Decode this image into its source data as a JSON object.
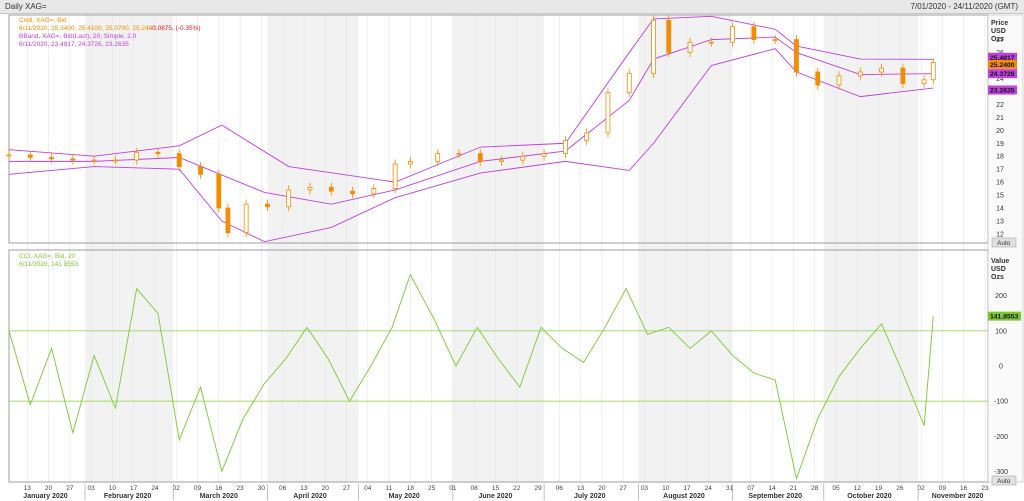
{
  "window": {
    "title": "Daily XAG=",
    "date_range": "7/01/2020 - 24/11/2020 (GMT)"
  },
  "legend_price": {
    "line1": "Cndl, XAG=, Bid",
    "line2_values": "6/11/2020, 25.3400, 25.4100, 25.0700, 25.2400,",
    "line2_change": "-0.0875, (-0.35%)",
    "line3": "BBand, XAG=, Bid(Last), 20, Simple, 2.0",
    "line4": "6/11/2020, 23.4817, 24.3726, 23.2635"
  },
  "legend_cci": {
    "line1": "CCI, XAG=, Bid, 20",
    "line2": "6/11/2020, 141.8553"
  },
  "axis_price": {
    "title_lines": [
      "Price",
      "USD",
      "Ozs"
    ],
    "ticks": [
      "27",
      "26",
      "25",
      "24",
      "23",
      "22",
      "21",
      "20",
      "19",
      "18",
      "17",
      "16",
      "15",
      "14",
      "13",
      "12"
    ],
    "badges": [
      "25.4817",
      "25.2400",
      "24.3726",
      "23.2635"
    ],
    "auto": "Auto"
  },
  "axis_cci": {
    "title_lines": [
      "Value",
      "USD",
      "Ozs"
    ],
    "ticks": [
      "200",
      "100",
      "0",
      "-100",
      "-200",
      "-300"
    ],
    "badge": "141.8553",
    "auto": "Auto"
  },
  "axis_x": {
    "day_ticks": [
      "13",
      "20",
      "27",
      "03",
      "10",
      "17",
      "24",
      "02",
      "09",
      "16",
      "23",
      "30",
      "06",
      "13",
      "20",
      "27",
      "04",
      "11",
      "18",
      "25",
      "01",
      "08",
      "15",
      "22",
      "29",
      "06",
      "13",
      "20",
      "27",
      "03",
      "10",
      "17",
      "24",
      "31",
      "07",
      "14",
      "21",
      "28",
      "05",
      "12",
      "19",
      "26",
      "02",
      "09",
      "16",
      "23"
    ],
    "months": [
      "January 2020",
      "February 2020",
      "March 2020",
      "April 2020",
      "May 2020",
      "June 2020",
      "July 2020",
      "August 2020",
      "September 2020",
      "October 2020",
      "November 2020"
    ]
  },
  "colors": {
    "candle": "#f28c00",
    "bband": "#c040e0",
    "cci": "#7cc832",
    "level_line": "#8ccf45",
    "change_negative": "#e02020",
    "badge_last": "#f28c00",
    "badge_band": "#c040e0",
    "badge_cci": "#7cc832"
  },
  "chart_data": [
    {
      "type": "candlestick",
      "title": "Daily XAG=",
      "series": [
        {
          "name": "Cndl, XAG=, Bid",
          "x": [
            "2020-01-07",
            "2020-01-14",
            "2020-01-21",
            "2020-01-28",
            "2020-02-04",
            "2020-02-11",
            "2020-02-18",
            "2020-02-25",
            "2020-03-03",
            "2020-03-10",
            "2020-03-16",
            "2020-03-19",
            "2020-03-25",
            "2020-04-01",
            "2020-04-08",
            "2020-04-15",
            "2020-04-22",
            "2020-04-29",
            "2020-05-06",
            "2020-05-13",
            "2020-05-18",
            "2020-05-27",
            "2020-06-03",
            "2020-06-10",
            "2020-06-17",
            "2020-06-24",
            "2020-07-01",
            "2020-07-08",
            "2020-07-15",
            "2020-07-22",
            "2020-07-29",
            "2020-08-06",
            "2020-08-11",
            "2020-08-18",
            "2020-08-25",
            "2020-09-01",
            "2020-09-08",
            "2020-09-15",
            "2020-09-22",
            "2020-09-29",
            "2020-10-06",
            "2020-10-13",
            "2020-10-20",
            "2020-10-27",
            "2020-11-03",
            "2020-11-06"
          ],
          "close": [
            18.1,
            17.9,
            17.8,
            17.7,
            17.7,
            17.7,
            18.3,
            18.2,
            17.2,
            16.6,
            14.0,
            12.1,
            14.3,
            14.1,
            15.4,
            15.6,
            15.3,
            15.1,
            15.5,
            17.4,
            17.6,
            18.2,
            18.2,
            17.6,
            17.7,
            18.0,
            18.2,
            19.2,
            19.8,
            22.9,
            24.4,
            28.5,
            26.0,
            26.8,
            26.8,
            28.0,
            27.0,
            27.0,
            24.5,
            23.5,
            24.2,
            24.5,
            24.8,
            23.6,
            23.9,
            25.24
          ]
        },
        {
          "name": "BBand upper",
          "x": [
            "2020-01-07",
            "2020-02-04",
            "2020-03-03",
            "2020-03-17",
            "2020-04-08",
            "2020-05-13",
            "2020-06-10",
            "2020-07-08",
            "2020-07-29",
            "2020-08-06",
            "2020-08-25",
            "2020-09-15",
            "2020-09-22",
            "2020-10-13",
            "2020-11-06"
          ],
          "values": [
            18.5,
            18.0,
            18.8,
            20.4,
            17.2,
            16.0,
            18.7,
            19.0,
            26.0,
            28.6,
            28.8,
            27.8,
            26.5,
            25.5,
            25.4817
          ]
        },
        {
          "name": "BBand middle",
          "x": [
            "2020-01-07",
            "2020-02-04",
            "2020-03-03",
            "2020-03-31",
            "2020-04-22",
            "2020-05-13",
            "2020-06-10",
            "2020-07-08",
            "2020-07-29",
            "2020-08-06",
            "2020-08-25",
            "2020-09-15",
            "2020-09-22",
            "2020-10-13",
            "2020-11-06"
          ],
          "values": [
            17.6,
            17.6,
            17.9,
            15.2,
            14.3,
            15.4,
            17.6,
            18.4,
            22.3,
            25.5,
            27.0,
            27.2,
            26.0,
            24.3,
            24.3726
          ]
        },
        {
          "name": "BBand lower",
          "x": [
            "2020-01-07",
            "2020-02-04",
            "2020-03-03",
            "2020-03-17",
            "2020-03-31",
            "2020-04-22",
            "2020-05-13",
            "2020-06-10",
            "2020-07-08",
            "2020-07-29",
            "2020-08-06",
            "2020-08-25",
            "2020-09-15",
            "2020-09-22",
            "2020-10-13",
            "2020-11-06"
          ],
          "values": [
            16.6,
            17.2,
            17.0,
            13.0,
            11.4,
            12.5,
            14.8,
            16.7,
            17.6,
            16.9,
            19.0,
            25.0,
            26.3,
            24.5,
            22.6,
            23.2635
          ]
        }
      ],
      "ylabel": "Price USD Ozs",
      "ylim": [
        11.3,
        28.9
      ]
    },
    {
      "type": "line",
      "title": "CCI, XAG=, Bid, 20",
      "series": [
        {
          "name": "CCI, XAG=, Bid, 20",
          "x": [
            "2020-01-07",
            "2020-01-14",
            "2020-01-21",
            "2020-01-28",
            "2020-02-04",
            "2020-02-11",
            "2020-02-18",
            "2020-02-25",
            "2020-03-03",
            "2020-03-10",
            "2020-03-17",
            "2020-03-24",
            "2020-03-31",
            "2020-04-07",
            "2020-04-14",
            "2020-04-21",
            "2020-04-28",
            "2020-05-05",
            "2020-05-12",
            "2020-05-18",
            "2020-05-26",
            "2020-06-02",
            "2020-06-09",
            "2020-06-16",
            "2020-06-23",
            "2020-06-30",
            "2020-07-07",
            "2020-07-14",
            "2020-07-21",
            "2020-07-28",
            "2020-08-04",
            "2020-08-11",
            "2020-08-18",
            "2020-08-25",
            "2020-09-01",
            "2020-09-08",
            "2020-09-15",
            "2020-09-22",
            "2020-09-29",
            "2020-10-06",
            "2020-10-13",
            "2020-10-20",
            "2020-10-27",
            "2020-11-03",
            "2020-11-06"
          ],
          "values": [
            100,
            -110,
            50,
            -190,
            30,
            -120,
            220,
            150,
            -210,
            -60,
            -300,
            -150,
            -50,
            20,
            110,
            20,
            -100,
            0,
            110,
            260,
            130,
            0,
            110,
            20,
            -60,
            110,
            50,
            10,
            110,
            220,
            90,
            110,
            50,
            100,
            30,
            -20,
            -40,
            -320,
            -150,
            -30,
            50,
            120,
            -20,
            -170,
            141.8553
          ]
        }
      ],
      "ylabel": "Value USD Ozs",
      "ylim": [
        -330,
        330
      ],
      "reference_lines": [
        100,
        -100
      ]
    }
  ]
}
